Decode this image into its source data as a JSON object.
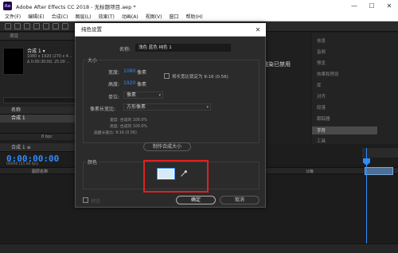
{
  "window": {
    "title": "Adobe After Effects CC 2018 - 无标题项目.aep *",
    "min": "—",
    "max": "☐",
    "close": "✕"
  },
  "menubar": [
    "文件(F)",
    "编辑(E)",
    "合成(C)",
    "图层(L)",
    "效果(T)",
    "动画(A)",
    "视图(V)",
    "窗口",
    "帮助(H)"
  ],
  "project_panel": {
    "tab": "项目",
    "comp_name": "合成 1 ▾",
    "comp_meta_1": "1080 x 1920 (270 x 4...",
    "comp_meta_2": "Δ 0:00:30:00, 25.00 ...",
    "column_name": "名称",
    "row_label": "合成 1",
    "footer_text": "8 bpc"
  },
  "timeline": {
    "tab": "合成 1 ≡",
    "timecode": "0:00:00:00",
    "subframe": "00000 (25.00 fps)",
    "header_layer": "图层名称",
    "header_parent": "父级"
  },
  "background_text": "渲染已禁用",
  "right_panel": {
    "items": [
      "信息",
      "音频",
      "预览",
      "效果和预设",
      "库",
      "对齐",
      "段落",
      "跟踪器",
      "字符",
      "工具"
    ]
  },
  "dialog": {
    "title": "纯色设置",
    "close": "✕",
    "name_label": "名称:",
    "name_value": "浅色 蓝色 纯色 1",
    "size_group": "大小",
    "width_label": "宽度:",
    "width_value": "1080",
    "width_unit": "像素",
    "height_label": "高度:",
    "height_value": "1920",
    "height_unit": "像素",
    "lock_ratio_label": "将长宽比锁定为 9:16 (0.56)",
    "unit_label": "单位:",
    "unit_value": "像素",
    "pixel_aspect_label": "像素长宽比:",
    "pixel_aspect_value": "方形像素",
    "info_width": "宽度: 合成的 100.0%",
    "info_height": "高度: 合成的 100.0%",
    "info_frame_aspect": "画面长宽比: 9:16 (0.56)",
    "make_comp_size": "制作合成大小",
    "color_group": "颜色",
    "color_value": "#d6eaf8",
    "preview_label": "预览",
    "ok": "确定",
    "cancel": "取消"
  }
}
